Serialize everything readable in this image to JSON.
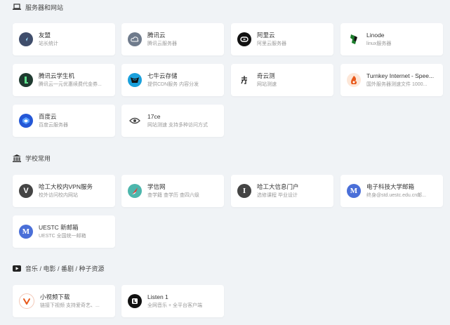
{
  "sections": [
    {
      "title": "服务器和网站",
      "icon": "laptop-icon"
    },
    {
      "title": "学校常用",
      "icon": "university-icon"
    },
    {
      "title": "音乐 / 电影 / 番剧 / 种子资源",
      "icon": "youtube-icon"
    }
  ],
  "servers": [
    {
      "title": "友盟",
      "desc": "站长统计",
      "icon": "umeng-icon"
    },
    {
      "title": "腾讯云",
      "desc": "腾讯云服务器",
      "icon": "cloud-icon"
    },
    {
      "title": "阿里云",
      "desc": "阿里云服务器",
      "icon": "aliyun-icon"
    },
    {
      "title": "Linode",
      "desc": "linux服务器",
      "icon": "linode-icon"
    },
    {
      "title": "腾讯云学生机",
      "desc": "腾讯云一元优惠续费代金券...",
      "icon": "tencent-student-icon"
    },
    {
      "title": "七牛云存储",
      "desc": "提供CDN服务 内容分发",
      "icon": "qiniu-icon"
    },
    {
      "title": "奇云测",
      "desc": "网站测速",
      "icon": "qiyunce-icon"
    },
    {
      "title": "Turnkey Internet - Spee...",
      "desc": "国外服务器测速文件 1000...",
      "icon": "turnkey-icon"
    },
    {
      "title": "百度云",
      "desc": "百度云服务器",
      "icon": "baidu-cloud-icon"
    },
    {
      "title": "17ce",
      "desc": "网站测速 支持多种访问方式",
      "icon": "eye-icon"
    }
  ],
  "school": [
    {
      "title": "哈工大校内VPN服务",
      "desc": "校外访问校内网站",
      "icon": "letter-v-icon"
    },
    {
      "title": "学信网",
      "desc": "查学籍 查学历 查四六级",
      "icon": "chsi-icon"
    },
    {
      "title": "哈工大信息门户",
      "desc": "选修课程 毕业设计",
      "icon": "letter-i-icon"
    },
    {
      "title": "电子科技大学邮箱",
      "desc": "终身@std.uestc.edu.cn邮...",
      "icon": "letter-m-icon"
    },
    {
      "title": "UESTC 新邮箱",
      "desc": "UESTC 全国统一邮箱",
      "icon": "letter-m-icon"
    }
  ],
  "media": [
    {
      "title": "小视频下载",
      "desc": "链接下视频 支持爱奇艺、...",
      "icon": "video-download-icon"
    },
    {
      "title": "Listen 1",
      "desc": "全网音乐 + 全平台客户端",
      "icon": "listen1-icon"
    }
  ]
}
